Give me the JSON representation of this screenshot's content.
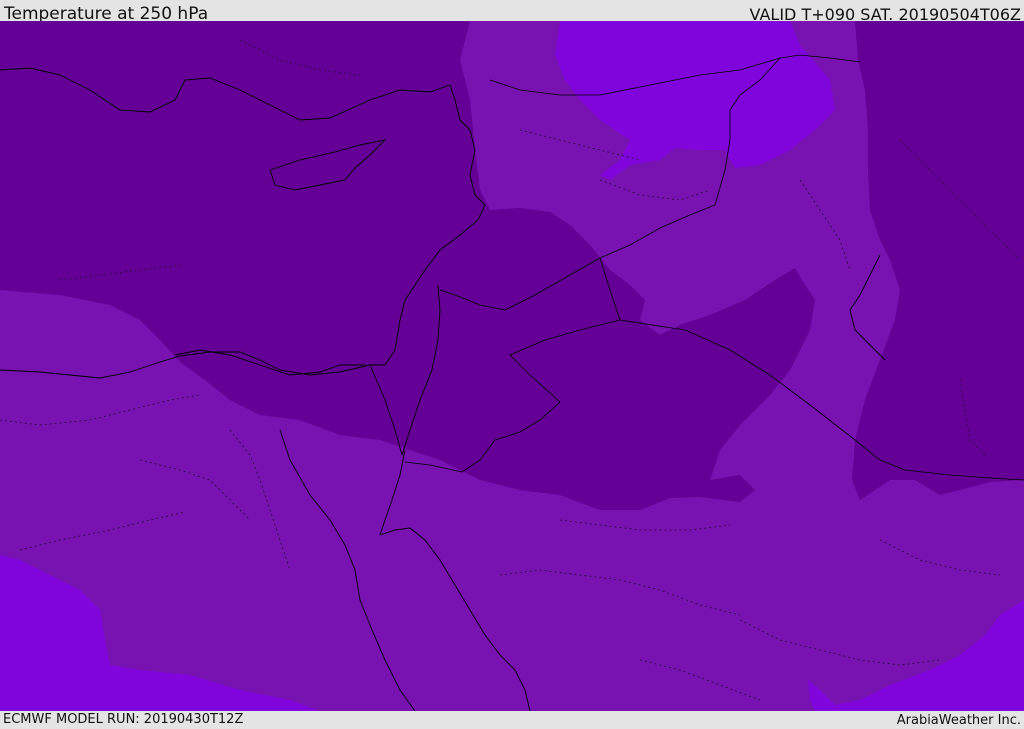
{
  "header": {
    "title": "Temperature at 250 hPa",
    "valid_time": "VALID T+090 SAT. 20190504T06Z"
  },
  "footer": {
    "model_run": "ECMWF MODEL RUN: 20190430T12Z",
    "brand": "ArabiaWeather Inc."
  },
  "palette": {
    "cold_dark": "#640096",
    "mid": "#7812b0",
    "warm_light": "#8004dc",
    "border_line": "#000000",
    "admin_line": "#2a0a40"
  }
}
